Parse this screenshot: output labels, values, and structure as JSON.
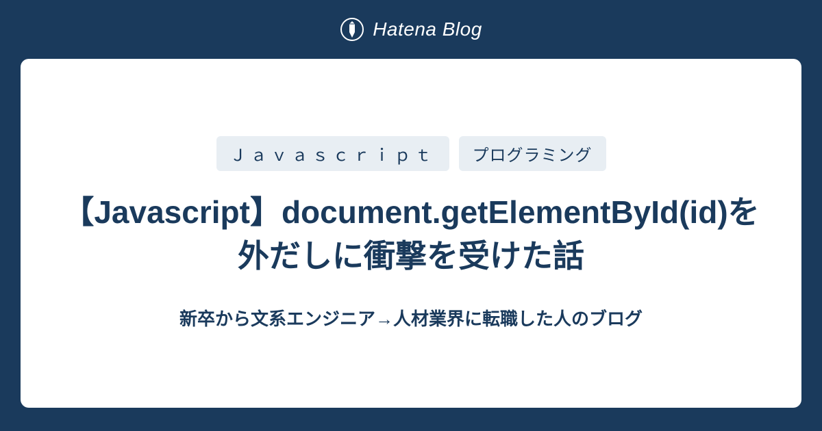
{
  "header": {
    "logo_text": "Hatena Blog"
  },
  "card": {
    "tags": [
      "Ｊａｖａｓｃｒｉｐｔ",
      "プログラミング"
    ],
    "title": "【Javascript】document.getElementById(id)を外だしに衝撃を受けた話",
    "subtitle": "新卒から文系エンジニア→人材業界に転職した人のブログ"
  }
}
